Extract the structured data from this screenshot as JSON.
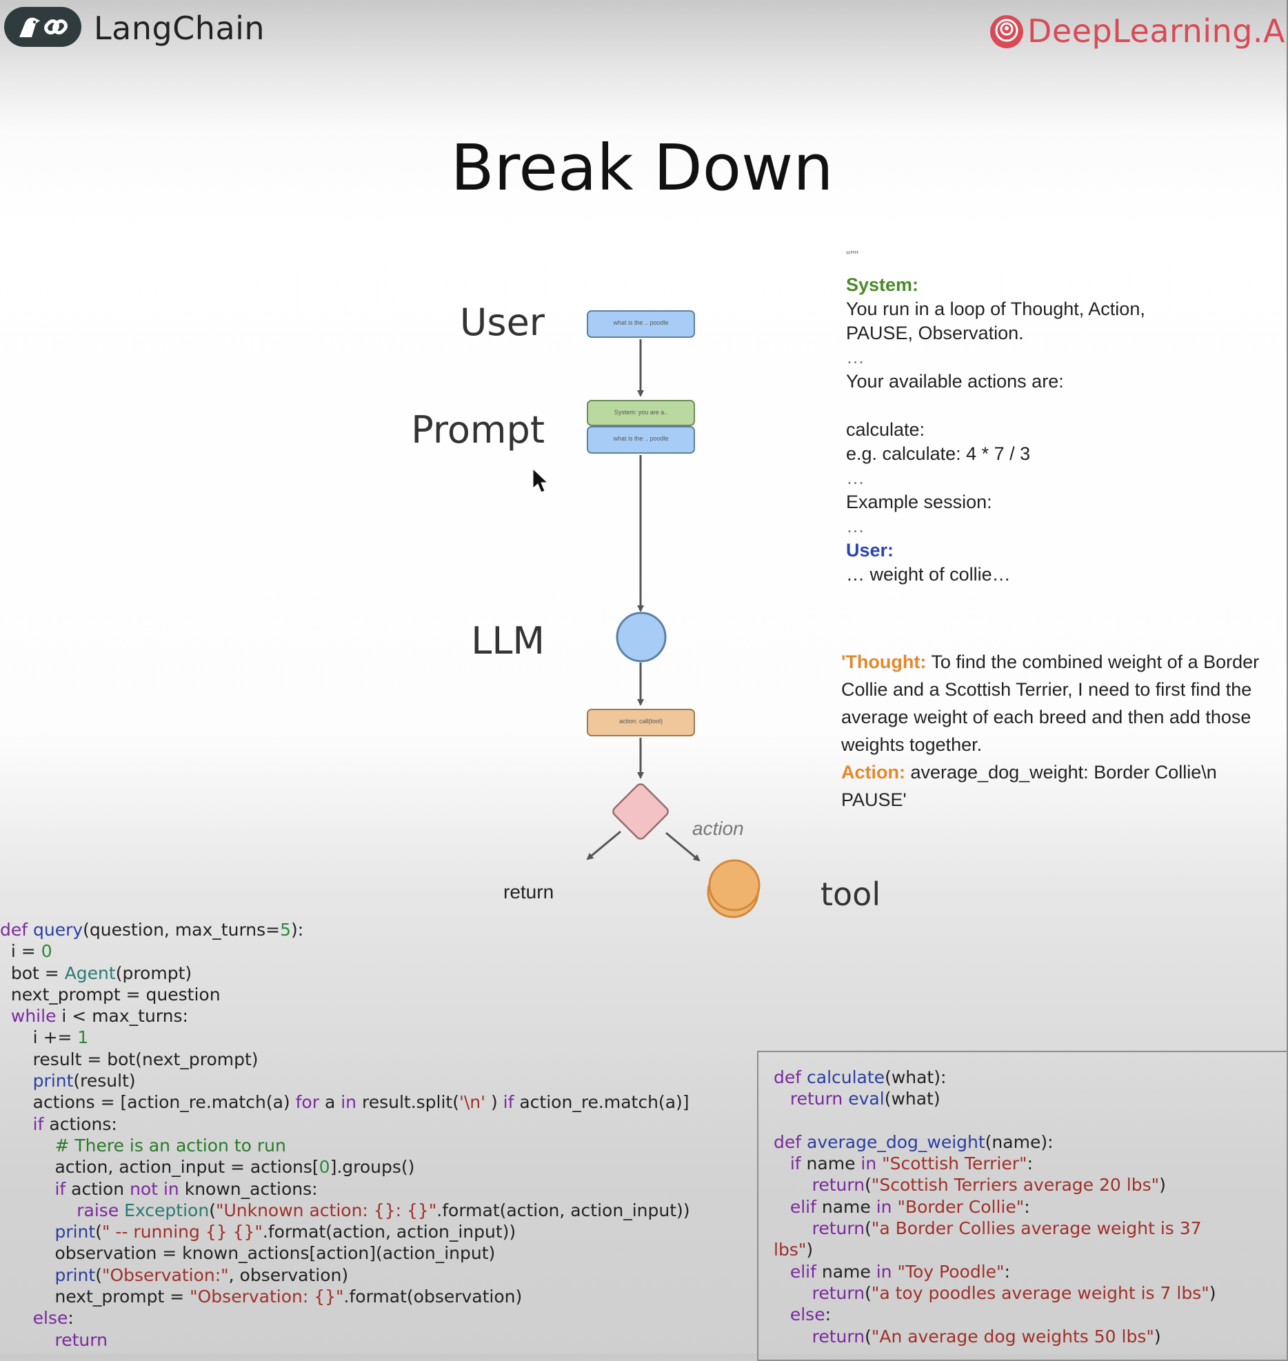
{
  "header": {
    "brand_left": "LangChain",
    "brand_right": "DeepLearning.AI",
    "brand_right_color": "#d94a55"
  },
  "slide": {
    "title": "Break Down"
  },
  "diagram": {
    "user_label": "User",
    "prompt_label": "Prompt",
    "llm_label": "LLM",
    "return_label": "return",
    "tool_label": "tool",
    "action_label": "action",
    "user_box_text": "what is the .. poodle",
    "system_box_text": "System: you are a..",
    "question_box_text": "what is the .. poodle",
    "action_box_text": "action: call(tool)",
    "colors": {
      "blue_fill": "#a7cdf7",
      "green_fill": "#b9d9a0",
      "orange_fill": "#f0c79b",
      "decision_fill": "#f2c2c4",
      "tool_fill": "#efb36e",
      "arrow": "#555555"
    }
  },
  "prompt_text": {
    "quotes": "“””",
    "system_label": "System:",
    "line1": "You run in a loop of Thought, Action,",
    "line2": "PAUSE, Observation.",
    "ellipsis": "…",
    "line3": "Your available actions are:",
    "line4": "calculate:",
    "line5": "e.g. calculate: 4 * 7 / 3",
    "line6": "Example session:",
    "user_label": "User:",
    "line7": "… weight of collie…"
  },
  "thought": {
    "thought_label": "'Thought:",
    "thought_text": " To find the combined weight of a Border Collie and a Scottish Terrier, I need to first find the average weight of each breed and then add those weights together.",
    "action_label": "Action:",
    "action_text": " average_dog_weight: Border Collie\\n PAUSE'"
  },
  "code_left": [
    [
      [
        "kw",
        "def "
      ],
      [
        "fn",
        "query"
      ],
      [
        "",
        "(question, max_turns="
      ],
      [
        "nu",
        "5"
      ],
      [
        "",
        "):"
      ]
    ],
    [
      [
        "",
        "  i = "
      ],
      [
        "nu",
        "0"
      ]
    ],
    [
      [
        "",
        "  bot = "
      ],
      [
        "cl",
        "Agent"
      ],
      [
        "",
        "(prompt)"
      ]
    ],
    [
      [
        "",
        "  next_prompt = question"
      ]
    ],
    [
      [
        "kw",
        "  while "
      ],
      [
        "",
        "i < max_turns:"
      ]
    ],
    [
      [
        "",
        "      i += "
      ],
      [
        "nu",
        "1"
      ]
    ],
    [
      [
        "",
        "      result = bot(next_prompt)"
      ]
    ],
    [
      [
        "fn",
        "      print"
      ],
      [
        "",
        "(result)"
      ]
    ],
    [
      [
        "",
        "      actions = [action_re.match(a) "
      ],
      [
        "kw",
        "for "
      ],
      [
        "",
        "a "
      ],
      [
        "kw",
        "in "
      ],
      [
        "",
        "result.split("
      ],
      [
        "st",
        "'\\n'"
      ],
      [
        "",
        " ) "
      ],
      [
        "kw",
        "if "
      ],
      [
        "",
        "action_re.match(a)]"
      ]
    ],
    [
      [
        "kw",
        "      if "
      ],
      [
        "",
        "actions:"
      ]
    ],
    [
      [
        "cm",
        "          # There is an action to run"
      ]
    ],
    [
      [
        "",
        "          action, action_input = actions["
      ],
      [
        "nu",
        "0"
      ],
      [
        "",
        "].groups()"
      ]
    ],
    [
      [
        "kw",
        "          if "
      ],
      [
        "",
        "action "
      ],
      [
        "kw",
        "not in "
      ],
      [
        "",
        "known_actions:"
      ]
    ],
    [
      [
        "kw",
        "              raise "
      ],
      [
        "cl",
        "Exception"
      ],
      [
        "",
        "("
      ],
      [
        "st",
        "\"Unknown action: {}: {}\""
      ],
      [
        "",
        ".format(action, action_input))"
      ]
    ],
    [
      [
        "fn",
        "          print"
      ],
      [
        "",
        "("
      ],
      [
        "st",
        "\" -- running {} {}\""
      ],
      [
        "",
        ".format(action, action_input))"
      ]
    ],
    [
      [
        "",
        "          observation = known_actions[action](action_input)"
      ]
    ],
    [
      [
        "fn",
        "          print"
      ],
      [
        "",
        "("
      ],
      [
        "st",
        "\"Observation:\""
      ],
      [
        "",
        ", observation)"
      ]
    ],
    [
      [
        "",
        "          next_prompt = "
      ],
      [
        "st",
        "\"Observation: {}\""
      ],
      [
        "",
        ".format(observation)"
      ]
    ],
    [
      [
        "kw",
        "      else"
      ],
      [
        "",
        ":"
      ]
    ],
    [
      [
        "kw",
        "          return"
      ]
    ]
  ],
  "code_right": [
    [
      [
        "kw",
        "def "
      ],
      [
        "fn",
        "calculate"
      ],
      [
        "",
        "(what):"
      ]
    ],
    [
      [
        "kw",
        "   return "
      ],
      [
        "fn",
        "eval"
      ],
      [
        "",
        "(what)"
      ]
    ],
    [
      [
        "",
        ""
      ]
    ],
    [
      [
        "kw",
        "def "
      ],
      [
        "fn",
        "average_dog_weight"
      ],
      [
        "",
        "(name):"
      ]
    ],
    [
      [
        "kw",
        "   if "
      ],
      [
        "",
        "name "
      ],
      [
        "kw",
        "in "
      ],
      [
        "st",
        "\"Scottish Terrier\""
      ],
      [
        "",
        ":"
      ]
    ],
    [
      [
        "kw",
        "       return"
      ],
      [
        "",
        "("
      ],
      [
        "st",
        "\"Scottish Terriers average 20 lbs\""
      ],
      [
        "",
        ")"
      ]
    ],
    [
      [
        "kw",
        "   elif "
      ],
      [
        "",
        "name "
      ],
      [
        "kw",
        "in "
      ],
      [
        "st",
        "\"Border Collie\""
      ],
      [
        "",
        ":"
      ]
    ],
    [
      [
        "kw",
        "       return"
      ],
      [
        "",
        "("
      ],
      [
        "st",
        "\"a Border Collies average weight is 37"
      ]
    ],
    [
      [
        "st",
        "lbs\""
      ],
      [
        "",
        ")"
      ]
    ],
    [
      [
        "kw",
        "   elif "
      ],
      [
        "",
        "name "
      ],
      [
        "kw",
        "in "
      ],
      [
        "st",
        "\"Toy Poodle\""
      ],
      [
        "",
        ":"
      ]
    ],
    [
      [
        "kw",
        "       return"
      ],
      [
        "",
        "("
      ],
      [
        "st",
        "\"a toy poodles average weight is 7 lbs\""
      ],
      [
        "",
        ")"
      ]
    ],
    [
      [
        "kw",
        "   else"
      ],
      [
        "",
        ":"
      ]
    ],
    [
      [
        "kw",
        "       return"
      ],
      [
        "",
        "("
      ],
      [
        "st",
        "\"An average dog weights 50 lbs\""
      ],
      [
        "",
        ")"
      ]
    ]
  ]
}
